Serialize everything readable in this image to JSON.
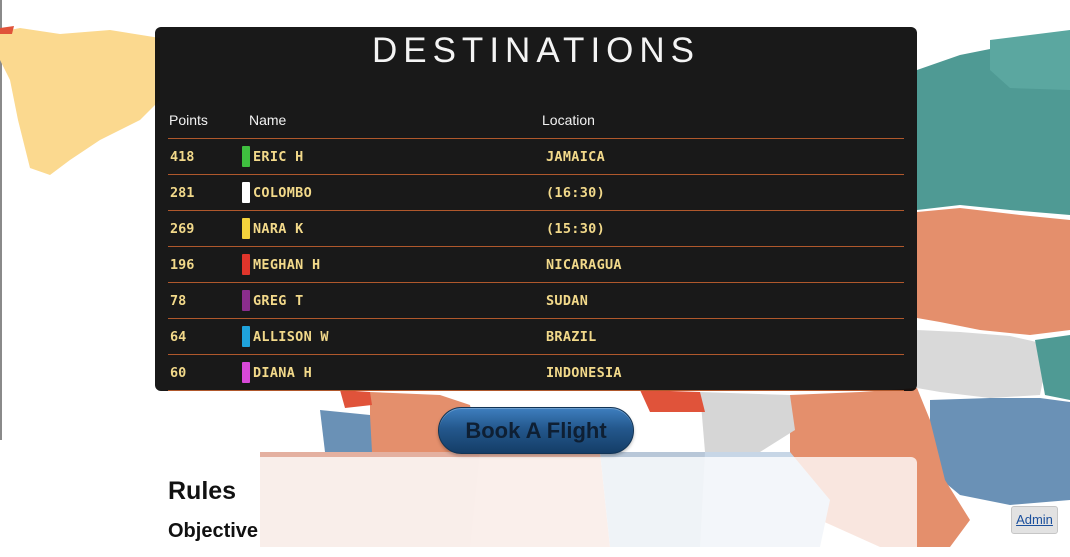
{
  "board": {
    "title": "DESTINATIONS",
    "columns": {
      "points": "Points",
      "name": "Name",
      "location": "Location"
    },
    "rows": [
      {
        "points": "418",
        "name": "ERIC H",
        "location": "JAMAICA",
        "color": "#3fbf3f"
      },
      {
        "points": "281",
        "name": "COLOMBO",
        "location": "(16:30)",
        "color": "#ffffff"
      },
      {
        "points": "269",
        "name": "NARA K",
        "location": "(15:30)",
        "color": "#f2d23c"
      },
      {
        "points": "196",
        "name": "MEGHAN H",
        "location": "NICARAGUA",
        "color": "#e0352b"
      },
      {
        "points": "78",
        "name": "GREG T",
        "location": "SUDAN",
        "color": "#8a2d8c"
      },
      {
        "points": "64",
        "name": "ALLISON W",
        "location": "BRAZIL",
        "color": "#1fa3dc"
      },
      {
        "points": "60",
        "name": "DIANA H",
        "location": "INDONESIA",
        "color": "#d949d9"
      }
    ]
  },
  "actions": {
    "book_label": "Book A Flight",
    "admin_label": "Admin"
  },
  "rules": {
    "title": "Rules",
    "objective": "Objective"
  },
  "colors": {
    "board_bg": "#080808",
    "row_text": "#f2d98a",
    "row_divider": "#b0582c",
    "button": "#24588d"
  }
}
